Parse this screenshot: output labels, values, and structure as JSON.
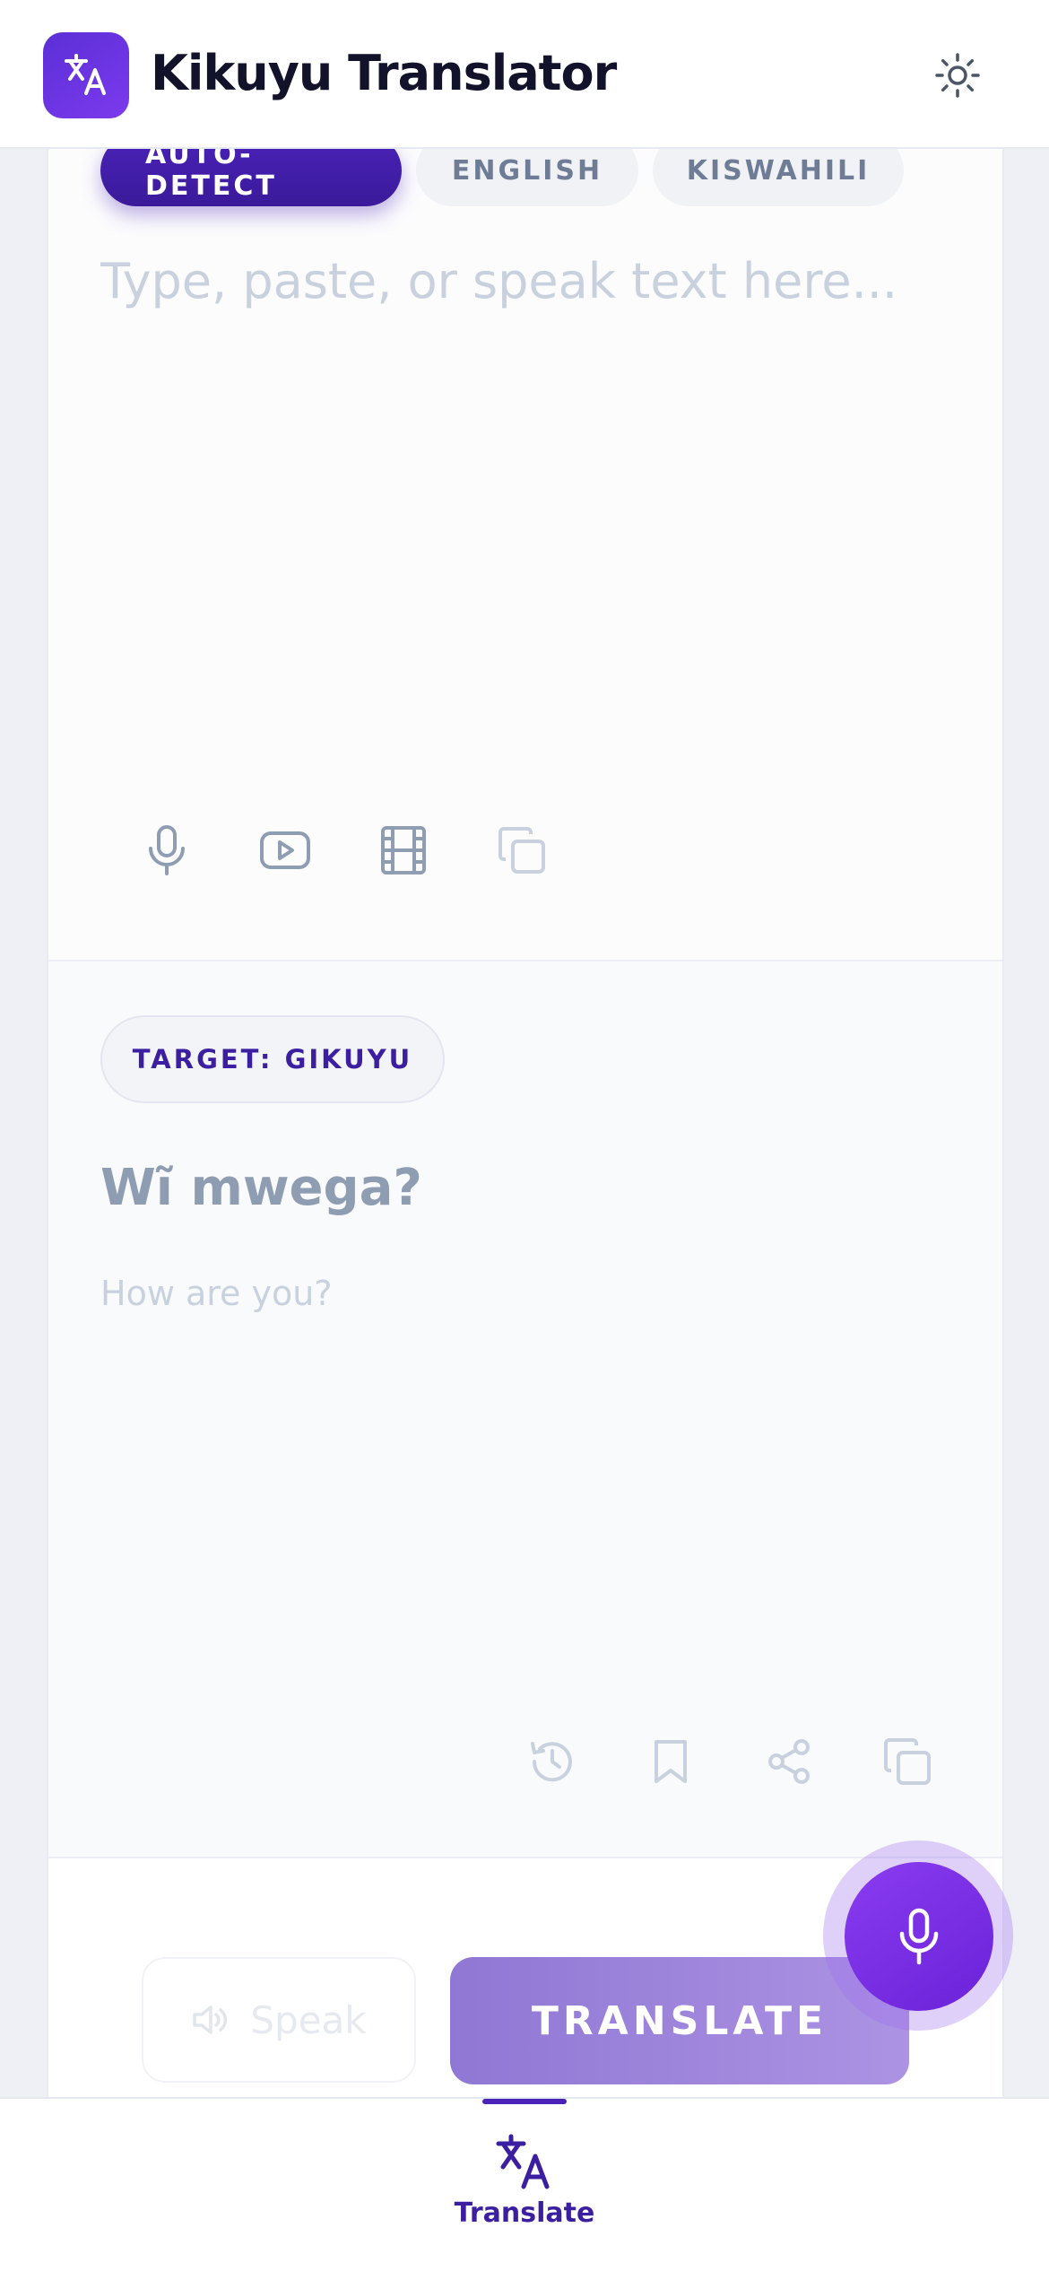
{
  "header": {
    "app_title": "Kikuyu Translator",
    "logo_icon": "translate-icon",
    "theme_icon": "sun-icon"
  },
  "source": {
    "language_chips": [
      {
        "label": "AUTO-DETECT",
        "active": true
      },
      {
        "label": "ENGLISH",
        "active": false
      },
      {
        "label": "KISWAHILI",
        "active": false
      }
    ],
    "input": {
      "value": "",
      "placeholder": "Type, paste, or speak text here..."
    },
    "tools": [
      "microphone-icon",
      "youtube-icon",
      "film-icon",
      "copy-icon"
    ]
  },
  "target": {
    "chip_label": "TARGET: GIKUYU",
    "translation": "Wĩ mwega?",
    "romanization": "How are you?",
    "tools": [
      "history-icon",
      "bookmark-icon",
      "share-icon",
      "copy-icon"
    ]
  },
  "actions": {
    "speak_label": "Speak",
    "translate_label": "TRANSLATE"
  },
  "fab": {
    "icon": "microphone-icon"
  },
  "bottom_nav": {
    "items": [
      {
        "label": "Translate",
        "icon": "translate-icon",
        "active": true
      }
    ]
  },
  "colors": {
    "primary": "#4a22b8",
    "accent": "#7c3aed",
    "muted_text": "#8e9db2",
    "placeholder_text": "#c9d1de"
  }
}
